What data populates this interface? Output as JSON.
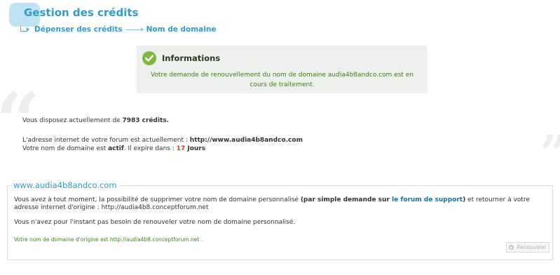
{
  "header": {
    "title": "Gestion des crédits",
    "breadcrumb": [
      "Dépenser des crédits",
      "Nom de domaine"
    ]
  },
  "info": {
    "title": "Informations",
    "message": "Votre demande de renouvellement du nom de domaine audia4b8andco.com est en cours de traitement."
  },
  "credits": {
    "line_prefix": "Vous disposez actuellement de ",
    "amount": "7983 crédits."
  },
  "forum": {
    "address_prefix": "L'adresse internet de votre forum est actuellement : ",
    "address": "http://www.audia4b8andco.com",
    "domain_prefix": "Votre nom de domaine est ",
    "status": "actif",
    "expiry_prefix": ". Il expire dans : ",
    "days": "17",
    "days_unit": " Jours"
  },
  "domain_section": {
    "legend": "www.audia4b8andco.com",
    "text_part1": "Vous avez à tout moment, la possibilité de supprimer votre nom de domaine personnalisé ",
    "text_bold_open": "(par simple demande sur ",
    "text_link": "le forum de support",
    "text_bold_close": ")",
    "text_part2": " et retourner à votre adresse internet d'origine : http://audia4b8.conceptforum.net",
    "no_renew_text": "Vous n'avez pour l'instant pas besoin de renouveler votre nom de domaine personnalisé.",
    "origin_text": "Votre nom de domaine d'origine est http://audia4b8.conceptforum.net .",
    "renew_button": "Renouveler"
  },
  "colors": {
    "accent": "#2e9ccd",
    "success": "#7ab93a",
    "alert": "#e43a2a"
  },
  "icons": {
    "info": "check-circle-icon",
    "renew": "arrow-circle-icon"
  }
}
